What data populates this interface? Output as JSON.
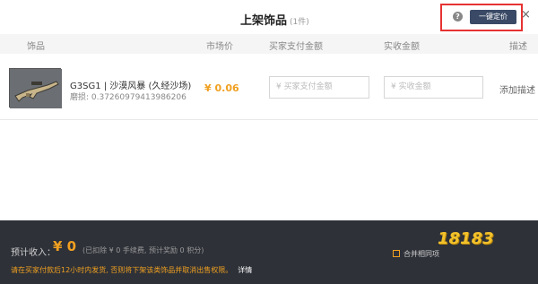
{
  "header": {
    "title": "上架饰品",
    "count": "(1件)",
    "help_glyph": "?",
    "price_button": "一键定价",
    "close_glyph": "×"
  },
  "columns": {
    "item": "饰品",
    "market_price": "市场价",
    "buyer_pays": "买家支付金额",
    "received": "实收金额",
    "description": "描述"
  },
  "rows": [
    {
      "name": "G3SG1 | 沙漠风暴 (久经沙场)",
      "wear": "磨损: 0.37260979413986206",
      "price": "¥ 0.06",
      "buyer_placeholder": "¥ 买家支付金额",
      "receive_placeholder": "¥ 实收金额",
      "add_description": "添加描述"
    }
  ],
  "footer": {
    "income_label": "预计收入：",
    "income_value": "¥ 0",
    "income_note": "(已扣除 ¥ 0 手续费, 预计奖励 0 积分)",
    "warning": "请在买家付款后12小时内发货, 否则将下架该类饰品并取消出售权限。",
    "detail_link": "详情",
    "merge_label": "合并相同项"
  },
  "watermark": "18183",
  "colors": {
    "accent_orange": "#f0a020",
    "button_navy": "#3a4a66",
    "highlight_red": "#e63232",
    "footer_bg": "#2e3138"
  }
}
